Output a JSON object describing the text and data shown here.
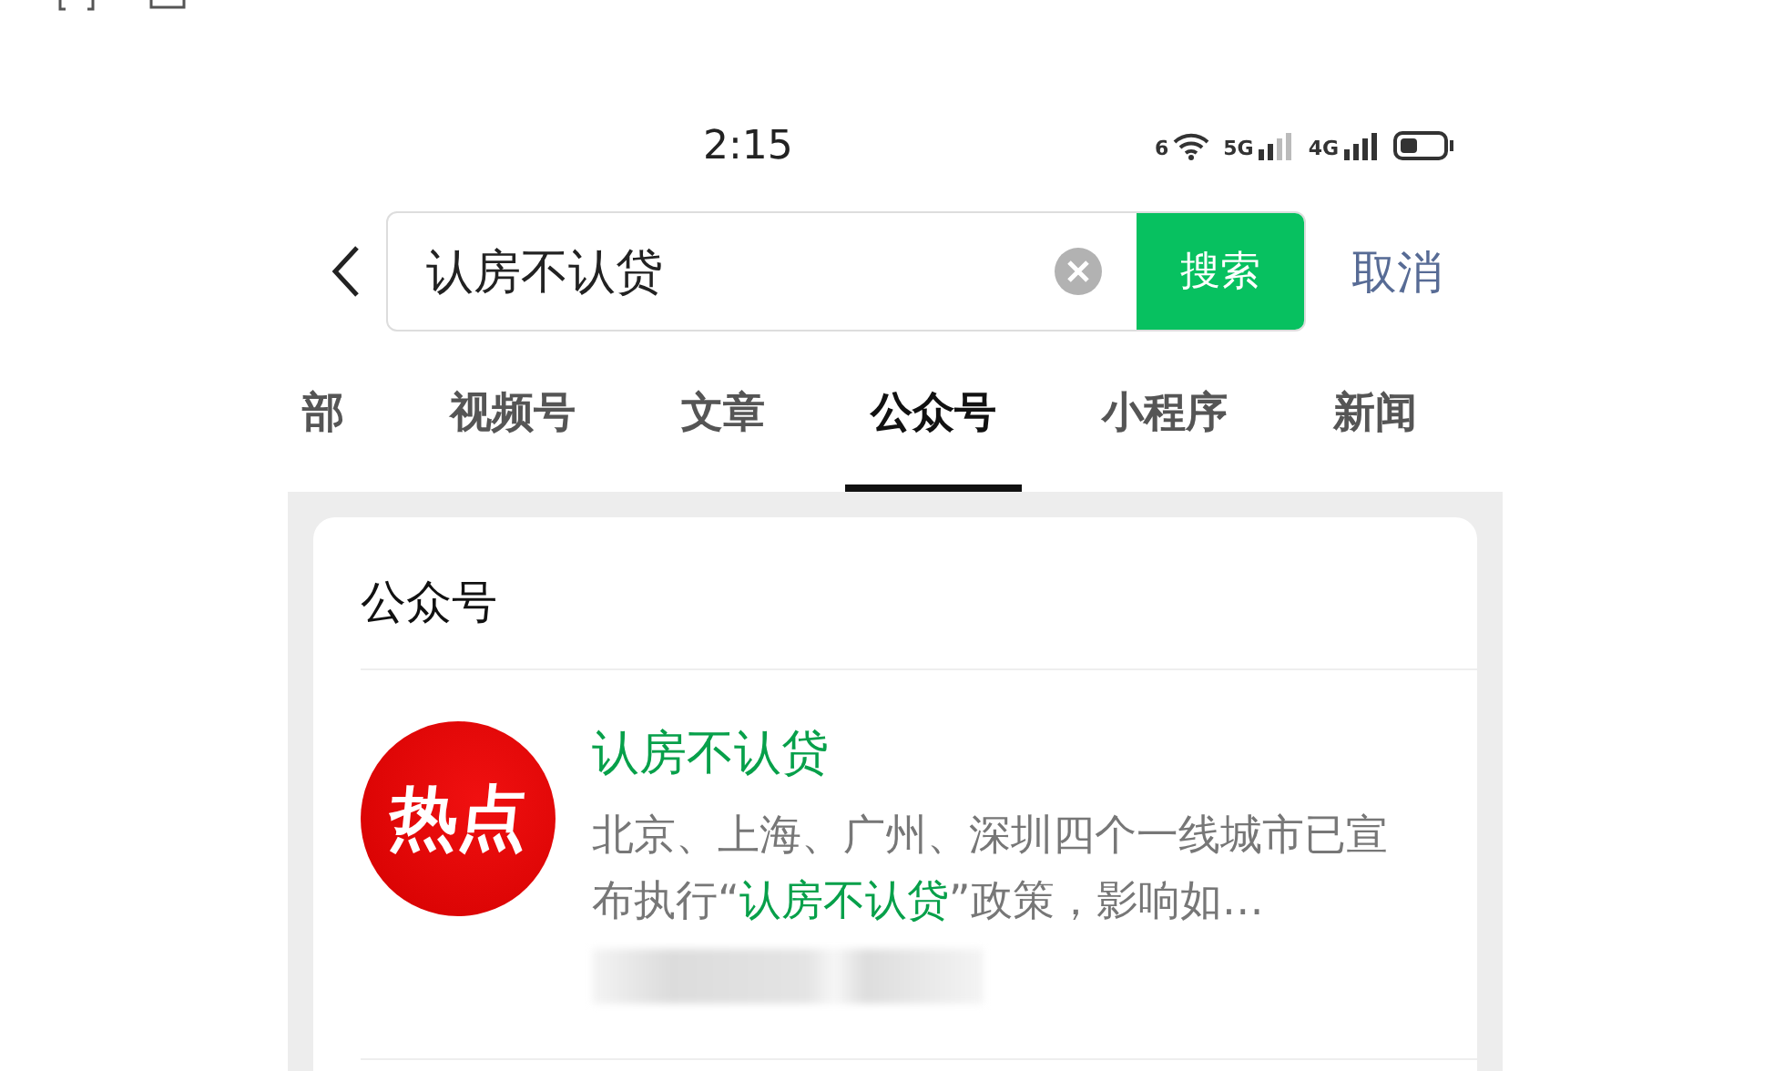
{
  "status_bar": {
    "time": "2:15",
    "wifi_badge": "6",
    "sim1_label": "5G",
    "sim2_label": "4G"
  },
  "search": {
    "value": "认房不认贷",
    "button": "搜索",
    "cancel": "取消"
  },
  "tabs": [
    {
      "label": "部",
      "selected": false
    },
    {
      "label": "视频号",
      "selected": false
    },
    {
      "label": "文章",
      "selected": false
    },
    {
      "label": "公众号",
      "selected": true
    },
    {
      "label": "小程序",
      "selected": false
    },
    {
      "label": "新闻",
      "selected": false
    }
  ],
  "section": {
    "title": "公众号",
    "results": [
      {
        "logo_text": "热点",
        "title": "认房不认贷",
        "description": [
          {
            "text": "北京、上海、广州、深圳四个一线城市已宣布执行“",
            "highlight": false
          },
          {
            "text": "认房不认贷",
            "highlight": true
          },
          {
            "text": "”政策，影响如…",
            "highlight": false
          }
        ]
      }
    ]
  }
}
